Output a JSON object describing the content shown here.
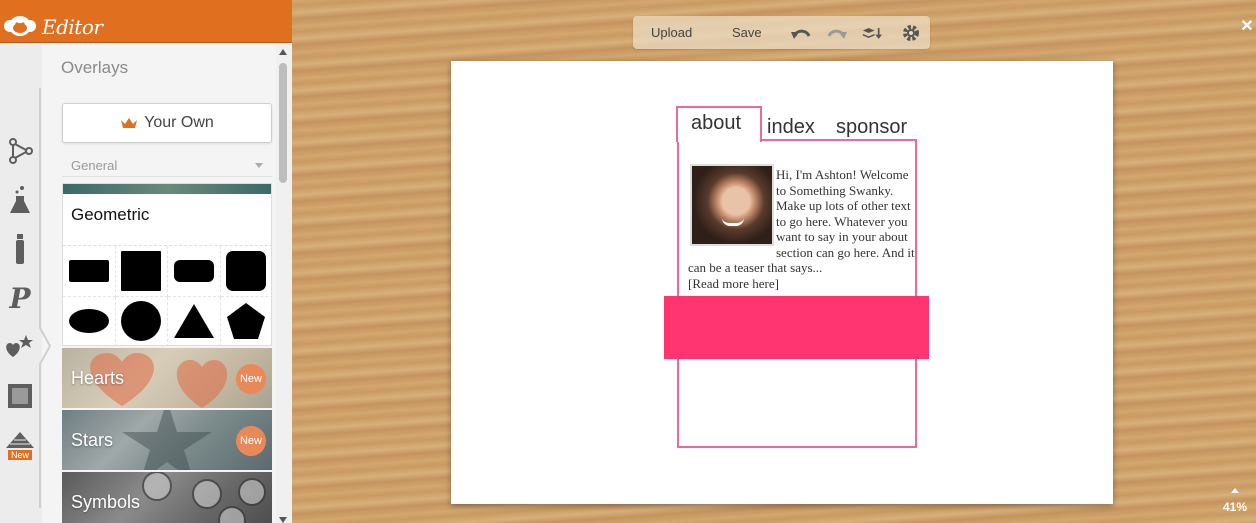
{
  "app": {
    "title": "Editor",
    "brand_color": "#e07020"
  },
  "sidebar": {
    "panel_title": "Overlays",
    "your_own_label": "Your Own",
    "category_select": "General",
    "tools": [
      {
        "icon": "nodes-icon"
      },
      {
        "icon": "flask-icon"
      },
      {
        "icon": "tube-icon"
      },
      {
        "icon": "text-p-icon"
      },
      {
        "icon": "overlays-icon"
      },
      {
        "icon": "frame-icon"
      },
      {
        "icon": "textures-icon",
        "badge": "New"
      }
    ],
    "geometric": {
      "title": "Geometric",
      "shapes": [
        "rectangle",
        "square",
        "rounded-rectangle",
        "rounded-square",
        "ellipse",
        "circle",
        "triangle",
        "pentagon"
      ]
    },
    "categories": [
      {
        "label": "Hearts",
        "badge": "New"
      },
      {
        "label": "Stars",
        "badge": "New"
      },
      {
        "label": "Symbols"
      }
    ]
  },
  "toolbar": {
    "upload_label": "Upload",
    "save_label": "Save",
    "icons": [
      "undo-icon",
      "redo-icon",
      "layers-icon",
      "settings-icon"
    ]
  },
  "canvas": {
    "tabs": [
      "about",
      "index",
      "sponsor"
    ],
    "about_text": "Hi, I'm Ashton! Welcome to Something Swanky. Make up lots of other text to go here. Whatever you want to say in your about section can go here. And it can be a teaser that says...",
    "read_more": "[Read more here]",
    "frame_color": "#e96a9b",
    "banner_color": "#ff3571"
  },
  "zoom": {
    "level": "41%"
  }
}
